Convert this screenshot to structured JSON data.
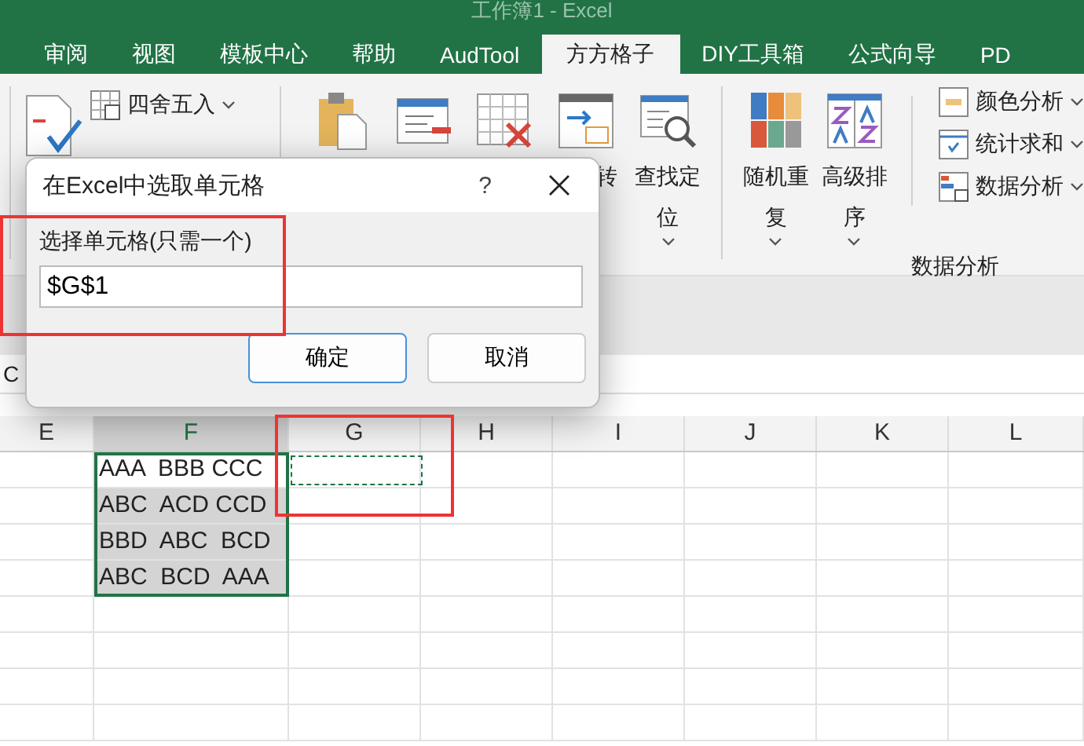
{
  "window": {
    "title": "工作簿1 - Excel"
  },
  "tabs": [
    {
      "label": "审阅",
      "selected": false
    },
    {
      "label": "视图",
      "selected": false
    },
    {
      "label": "模板中心",
      "selected": false
    },
    {
      "label": "帮助",
      "selected": false
    },
    {
      "label": "AudTool",
      "selected": false
    },
    {
      "label": "方方格子",
      "selected": true
    },
    {
      "label": "DIY工具箱",
      "selected": false
    },
    {
      "label": "公式向导",
      "selected": false
    },
    {
      "label": "PD",
      "selected": false
    }
  ],
  "ribbon": {
    "round_tool": {
      "label": "四舍五入",
      "dropdown": true
    },
    "mid_buttons": [
      {
        "kind": "clipboard"
      },
      {
        "kind": "form"
      },
      {
        "kind": "grid-x"
      },
      {
        "kind": "convert",
        "label": "转"
      },
      {
        "kind": "find",
        "label": "查找定位",
        "dropdown": true
      }
    ],
    "analysis_buttons": [
      {
        "kind": "tiles",
        "label": "随机重复",
        "dropdown": true
      },
      {
        "kind": "sort",
        "label": "高级排序",
        "dropdown": true
      }
    ],
    "analysis_menu": [
      {
        "kind": "color",
        "label": "颜色分析",
        "dropdown": true
      },
      {
        "kind": "sum",
        "label": "统计求和",
        "dropdown": true
      },
      {
        "kind": "data",
        "label": "数据分析",
        "dropdown": true
      }
    ],
    "group_label": "数据分析"
  },
  "formula_bar": {
    "value": "C"
  },
  "sheet": {
    "columns": [
      {
        "label": "E",
        "selected": false
      },
      {
        "label": "F",
        "selected": true
      },
      {
        "label": "G",
        "selected": false
      },
      {
        "label": "H",
        "selected": false
      },
      {
        "label": "I",
        "selected": false
      },
      {
        "label": "J",
        "selected": false
      },
      {
        "label": "K",
        "selected": false
      },
      {
        "label": "L",
        "selected": false
      }
    ],
    "rows": [
      {
        "f": "AAA  BBB CCC",
        "selected": false,
        "marquee": true
      },
      {
        "f": "ABC  ACD CCD",
        "selected": true,
        "marquee": false
      },
      {
        "f": "BBD  ABC  BCD",
        "selected": true,
        "marquee": false
      },
      {
        "f": "ABC  BCD  AAA",
        "selected": true,
        "marquee": false
      }
    ]
  },
  "dialog": {
    "title": "在Excel中选取单元格",
    "help": "?",
    "field_label": "选择单元格(只需一个)",
    "value": "$G$1",
    "buttons": [
      {
        "label": "确定",
        "default": true
      },
      {
        "label": "取消",
        "default": false
      }
    ]
  }
}
